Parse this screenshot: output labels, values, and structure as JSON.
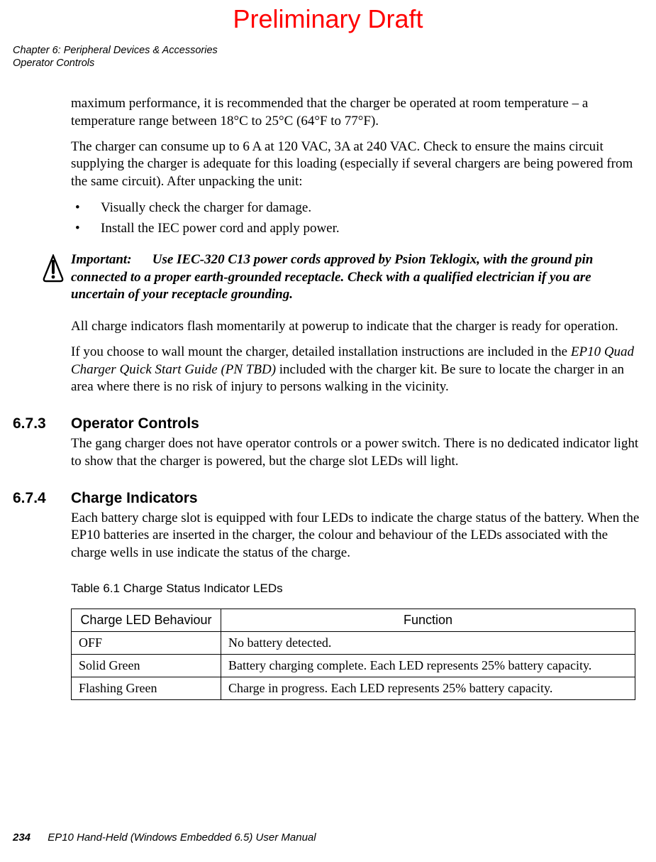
{
  "draft": "Preliminary Draft",
  "header": {
    "line1": "Chapter 6: Peripheral Devices & Accessories",
    "line2": "Operator Controls"
  },
  "body": {
    "p1": "maximum performance, it is recommended that the charger be operated at room temperature – a temperature range between 18°C to 25°C (64°F to 77°F).",
    "p2": "The charger can consume up to 6 A at 120 VAC, 3A at 240 VAC. Check to ensure the mains circuit supplying the charger is adequate for this loading (especially if several chargers are being powered from the same circuit). After unpacking the unit:",
    "bullets": [
      "Visually check the charger for damage.",
      "Install the IEC power cord and apply power."
    ],
    "important_label": "Important:",
    "important_text": "Use IEC-320 C13 power cords approved by Psion Teklogix, with the ground pin connected to a proper earth-grounded receptacle. Check with a qualified electrician if you are uncertain of your receptacle grounding.",
    "p3": "All charge indicators flash momentarily at powerup to indicate that the charger is ready for operation.",
    "p4_pre": "If you choose to wall mount the charger, detailed installation instructions are included in the ",
    "p4_italic": "EP10 Quad Charger Quick Start Guide (PN TBD)",
    "p4_post": " included with the charger kit. Be sure to locate the charger in an area where there is no risk of injury to persons walking in the vicinity."
  },
  "sections": {
    "s673_num": "6.7.3",
    "s673_title": "Operator Controls",
    "s673_p": "The gang charger does not have operator controls or a power switch. There is no dedicated indicator light to show that the charger is powered, but the charge slot LEDs will light.",
    "s674_num": "6.7.4",
    "s674_title": "Charge Indicators",
    "s674_p": "Each battery charge slot is equipped with four LEDs to indicate the charge status of the battery. When the EP10 batteries are inserted in the charger, the colour and behaviour of the LEDs associated with the charge wells in use indicate the status of the charge."
  },
  "table": {
    "caption": "Table 6.1   Charge Status Indicator LEDs",
    "h1": "Charge LED Behaviour",
    "h2": "Function",
    "rows": [
      {
        "c1": "OFF",
        "c2": "No battery detected."
      },
      {
        "c1": "Solid Green",
        "c2": "Battery charging complete. Each LED represents 25% battery capacity."
      },
      {
        "c1": "Flashing Green",
        "c2": "Charge in progress. Each LED represents 25% battery capacity."
      }
    ]
  },
  "footer": {
    "page": "234",
    "text": "EP10 Hand-Held (Windows Embedded 6.5) User Manual"
  }
}
